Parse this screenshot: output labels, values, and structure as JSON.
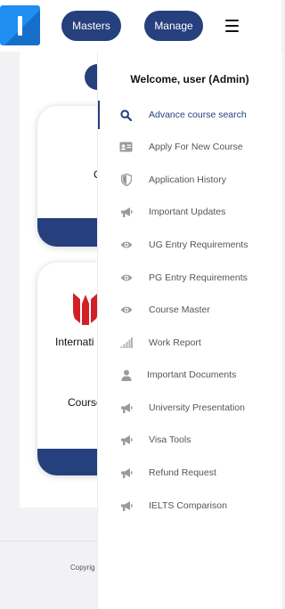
{
  "header": {
    "masters_label": "Masters",
    "manage_label": "Manage"
  },
  "background": {
    "card1_partial_text": "C",
    "card2_partial_text_1": "Internati",
    "card2_partial_text_2": "Course",
    "copyright_partial": "Copyrig"
  },
  "menu": {
    "welcome": "Welcome, user (Admin)",
    "items": [
      {
        "label": "Advance course search",
        "icon": "search-icon"
      },
      {
        "label": "Apply For New Course",
        "icon": "id-card-icon"
      },
      {
        "label": "Application History",
        "icon": "shield-icon"
      },
      {
        "label": "Important Updates",
        "icon": "megaphone-icon"
      },
      {
        "label": "UG Entry Requirements",
        "icon": "eye-icon"
      },
      {
        "label": "PG Entry Requirements",
        "icon": "eye-icon"
      },
      {
        "label": "Course Master",
        "icon": "eye-icon"
      },
      {
        "label": "Work Report",
        "icon": "signal-bars-icon"
      },
      {
        "label": "Important Documents",
        "icon": "user-icon"
      },
      {
        "label": "University Presentation",
        "icon": "megaphone-icon"
      },
      {
        "label": "Visa Tools",
        "icon": "megaphone-icon"
      },
      {
        "label": "Refund Request",
        "icon": "megaphone-icon"
      },
      {
        "label": "IELTS Comparison",
        "icon": "megaphone-icon"
      }
    ]
  },
  "colors": {
    "brand_navy": "#263f7d",
    "logo_blue": "#1f8ef1",
    "menu_text": "#555555",
    "university_logo_red": "#d32027"
  }
}
